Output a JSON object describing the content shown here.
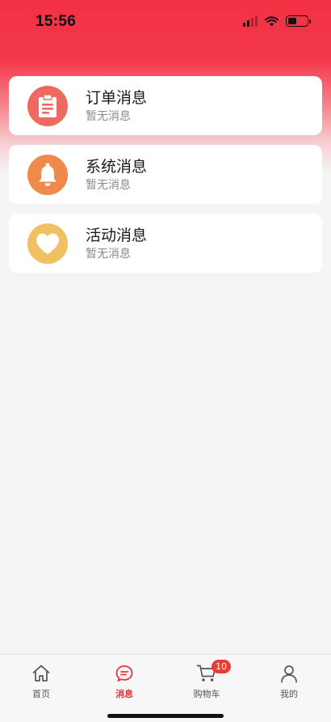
{
  "status_bar": {
    "time": "15:56",
    "battery_level": 0.45
  },
  "messages": [
    {
      "title": "订单消息",
      "subtitle": "暂无消息",
      "icon": "clipboard-icon",
      "color": "#ee6a5f"
    },
    {
      "title": "系统消息",
      "subtitle": "暂无消息",
      "icon": "bell-icon",
      "color": "#f08a4b"
    },
    {
      "title": "活动消息",
      "subtitle": "暂无消息",
      "icon": "heart-icon",
      "color": "#f1c063"
    }
  ],
  "tabbar": {
    "items": [
      {
        "label": "首页",
        "icon": "home-icon"
      },
      {
        "label": "消息",
        "icon": "message-icon",
        "active": true
      },
      {
        "label": "购物车",
        "icon": "cart-icon",
        "badge": "10"
      },
      {
        "label": "我的",
        "icon": "user-icon"
      }
    ]
  },
  "colors": {
    "accent": "#e8323c",
    "badge": "#ef3b36"
  }
}
